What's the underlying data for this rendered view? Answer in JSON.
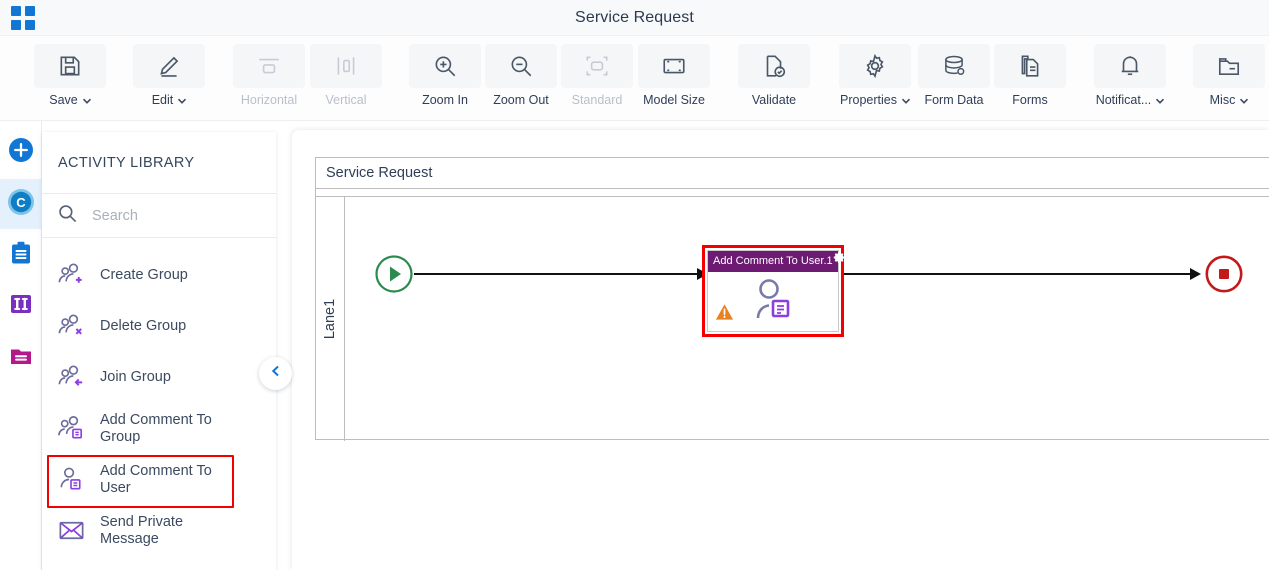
{
  "window": {
    "title": "Service Request",
    "logo_icon": "app-grid-icon"
  },
  "toolbar": {
    "items": [
      {
        "label": "Save",
        "icon": "save-floppy-icon",
        "caret": true,
        "disabled": false
      },
      {
        "label": "Edit",
        "icon": "pencil-edit-icon",
        "caret": true,
        "disabled": false
      },
      {
        "label": "Horizontal",
        "icon": "align-horizontal-icon",
        "caret": false,
        "disabled": true
      },
      {
        "label": "Vertical",
        "icon": "align-vertical-icon",
        "caret": false,
        "disabled": true
      },
      {
        "label": "Zoom In",
        "icon": "zoom-in-icon",
        "caret": false,
        "disabled": false
      },
      {
        "label": "Zoom Out",
        "icon": "zoom-out-icon",
        "caret": false,
        "disabled": false
      },
      {
        "label": "Standard",
        "icon": "standard-size-icon",
        "caret": false,
        "disabled": true
      },
      {
        "label": "Model Size",
        "icon": "model-size-icon",
        "caret": false,
        "disabled": false
      },
      {
        "label": "Validate",
        "icon": "validate-doc-icon",
        "caret": false,
        "disabled": false
      },
      {
        "label": "Properties",
        "icon": "gear-icon",
        "caret": true,
        "disabled": false
      },
      {
        "label": "Form Data",
        "icon": "database-icon",
        "caret": false,
        "disabled": false
      },
      {
        "label": "Forms",
        "icon": "forms-doc-icon",
        "caret": false,
        "disabled": false
      },
      {
        "label": "Notificat...",
        "icon": "bell-icon",
        "caret": true,
        "disabled": false
      },
      {
        "label": "Misc",
        "icon": "folder-misc-icon",
        "caret": true,
        "disabled": false
      }
    ]
  },
  "rail": {
    "items": [
      {
        "name": "add-new-icon",
        "icon": "plus-circle-icon",
        "active": false,
        "color": "#1277d4"
      },
      {
        "name": "components-icon",
        "icon": "c-circle-icon",
        "active": true,
        "color": "#1a8fd1"
      },
      {
        "name": "clipboard-icon",
        "icon": "clipboard-icon",
        "active": false,
        "color": "#1277d4"
      },
      {
        "name": "columns-icon",
        "icon": "columns-icon",
        "active": false,
        "color": "#7b2fbe"
      },
      {
        "name": "folder-icon",
        "icon": "folder-icon",
        "active": false,
        "color": "#b5188a"
      }
    ]
  },
  "panel": {
    "title": "ACTIVITY LIBRARY",
    "search": {
      "placeholder": "Search",
      "value": "",
      "icon": "search-icon"
    },
    "items": [
      {
        "label": "",
        "icon": "comment-bubble-icon",
        "highlighted": false,
        "partial": true
      },
      {
        "label": "Create Group",
        "icon": "user-group-add-icon",
        "highlighted": false
      },
      {
        "label": "Delete Group",
        "icon": "user-group-delete-icon",
        "highlighted": false
      },
      {
        "label": "Join Group",
        "icon": "user-group-join-icon",
        "highlighted": false
      },
      {
        "label": "Add Comment To Group",
        "icon": "user-group-comment-icon",
        "highlighted": false
      },
      {
        "label": "Add Comment To User",
        "icon": "user-comment-icon",
        "highlighted": true
      },
      {
        "label": "Send Private Message",
        "icon": "envelope-message-icon",
        "highlighted": false
      }
    ],
    "collapse_button": {
      "icon": "chevron-left-icon"
    }
  },
  "canvas": {
    "pool_name": "Service Request",
    "lane_name": "Lane1",
    "start_event": {
      "icon": "start-play-icon",
      "color": "#228b45"
    },
    "end_event": {
      "icon": "end-stop-icon",
      "color": "#c21a1a"
    },
    "activity": {
      "title": "Add Comment To User.1",
      "header_color": "#6d1a72",
      "selected_color": "#f40000",
      "gear_icon": "gear-icon",
      "warning_icon": "warning-triangle-icon",
      "glyph_icon": "user-comment-icon"
    }
  }
}
